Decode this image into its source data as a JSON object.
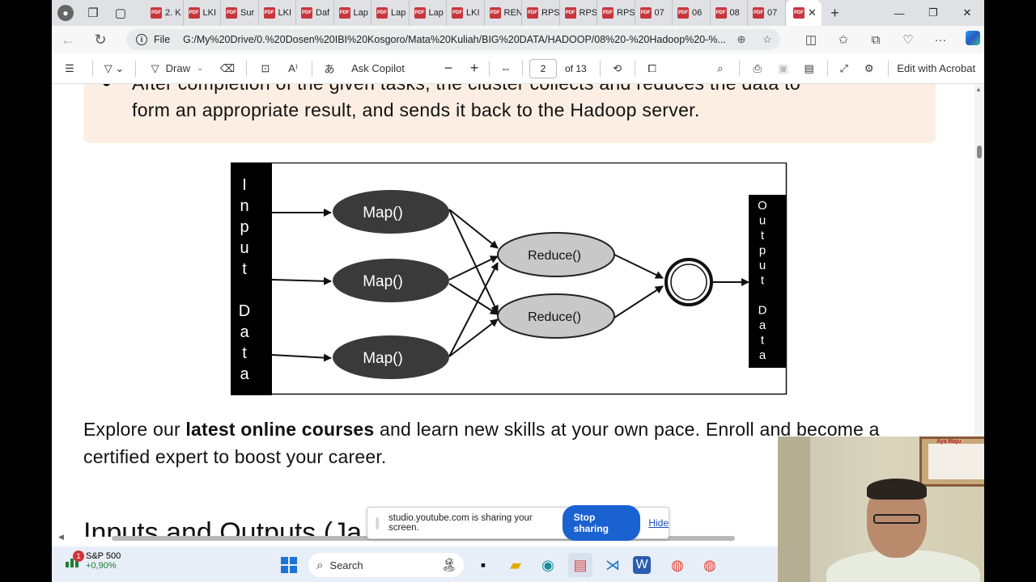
{
  "browser": {
    "tabs": [
      {
        "label": "2. K"
      },
      {
        "label": "LKI"
      },
      {
        "label": "Sur"
      },
      {
        "label": "LKI"
      },
      {
        "label": "Daf"
      },
      {
        "label": "Lap"
      },
      {
        "label": "Lap"
      },
      {
        "label": "Lap"
      },
      {
        "label": "LKI"
      },
      {
        "label": "REN"
      },
      {
        "label": "RPS"
      },
      {
        "label": "RPS"
      },
      {
        "label": "RPS"
      },
      {
        "label": "07"
      },
      {
        "label": "06"
      },
      {
        "label": "08"
      },
      {
        "label": "07"
      }
    ],
    "address": {
      "scheme": "File",
      "url": "G:/My%20Drive/0.%20Dosen%20IBI%20Kosgoro/Mata%20Kuliah/BIG%20DATA/HADOOP/08%20-%20Hadoop%20-%..."
    }
  },
  "pdf_toolbar": {
    "draw_label": "Draw",
    "ask_copilot_label": "Ask Copilot",
    "page_current": "2",
    "page_total_label": "of 13",
    "edit_acrobat_label": "Edit with Acrobat"
  },
  "document": {
    "callout_line1": "After completion of the given tasks, the cluster collects and reduces the data to",
    "callout_line2": "form an appropriate result, and sends it back to the Hadoop server.",
    "diagram": {
      "input_letters": [
        "I",
        "n",
        "p",
        "u",
        "t",
        "",
        "D",
        "a",
        "t",
        "a"
      ],
      "output_letters": [
        "O",
        "u",
        "t",
        "p",
        "u",
        "t",
        "",
        "D",
        "a",
        "t",
        "a"
      ],
      "map_label": "Map()",
      "reduce_label": "Reduce()"
    },
    "promo_before": "Explore our ",
    "promo_bold": "latest online courses",
    "promo_after": " and learn new skills at your own pace. Enroll and become a certified expert to boost your career.",
    "next_heading_partial": "Inputs and Outputs (Ja"
  },
  "sharing_banner": {
    "message": "studio.youtube.com is sharing your screen.",
    "stop_label": "Stop sharing",
    "hide_label": "Hide"
  },
  "taskbar": {
    "stock_name": "S&P 500",
    "stock_change": "+0,90%",
    "stock_badge": "1",
    "search_placeholder": "Search"
  },
  "webcam": {
    "poster_title": "Aya Maju"
  },
  "colors": {
    "callout_bg": "#fdeee3",
    "stop_button": "#1a62d2",
    "accent": "#1c74d4"
  }
}
